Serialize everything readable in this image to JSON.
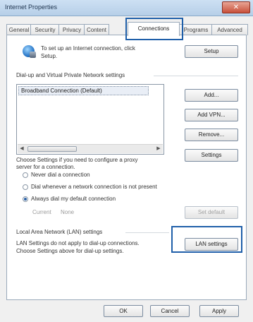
{
  "window": {
    "title": "Internet Properties",
    "close": "✕"
  },
  "tabs": [
    "General",
    "Security",
    "Privacy",
    "Content",
    "Connections",
    "Programs",
    "Advanced"
  ],
  "setup": {
    "text_line1": "To set up an Internet connection, click",
    "text_line2": "Setup.",
    "button": "Setup"
  },
  "dialup": {
    "group_label": "Dial-up and Virtual Private Network settings",
    "list_item": "Broadband Connection (Default)",
    "add": "Add...",
    "add_vpn": "Add VPN...",
    "remove": "Remove...",
    "settings_hint_line1": "Choose Settings if you need to configure a proxy",
    "settings_hint_line2": "server for a connection.",
    "settings": "Settings",
    "radio_never": "Never dial a connection",
    "radio_no_network": "Dial whenever a network connection is not present",
    "radio_always": "Always dial my default connection",
    "current_label": "Current",
    "current_value": "None",
    "set_default": "Set default"
  },
  "lan": {
    "group_label": "Local Area Network (LAN) settings",
    "text_line1": "LAN Settings do not apply to dial-up connections.",
    "text_line2": "Choose Settings above for dial-up settings.",
    "button": "LAN settings"
  },
  "footer": {
    "ok": "OK",
    "cancel": "Cancel",
    "apply": "Apply"
  }
}
